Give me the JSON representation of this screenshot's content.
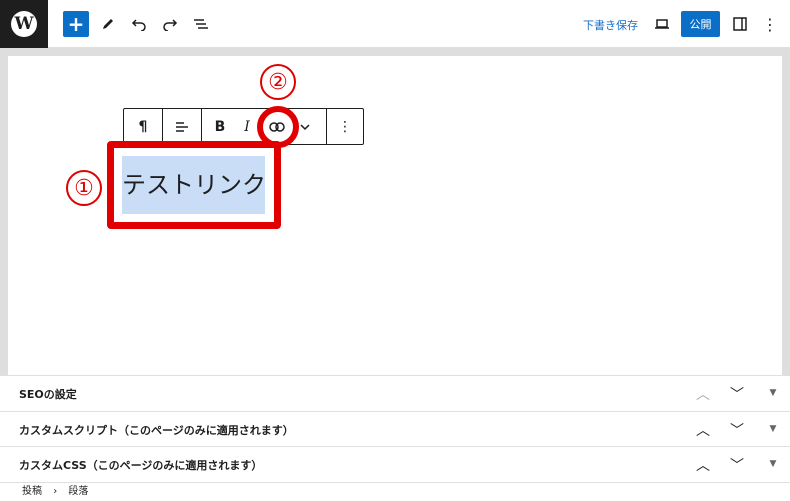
{
  "topbar": {
    "draft_save": "下書き保存",
    "publish": "公開"
  },
  "toolbar": {
    "paragraph": "¶",
    "bold": "B",
    "italic": "I",
    "more": "⋮"
  },
  "editor": {
    "selected_text": "テストリンク"
  },
  "annotations": {
    "one": "①",
    "two": "②"
  },
  "panels": [
    {
      "title": "SEOの設定"
    },
    {
      "title": "カスタムスクリプト（このページのみに適用されます）"
    },
    {
      "title": "カスタムCSS（このページのみに適用されます）"
    }
  ],
  "breadcrumb": {
    "first": "投稿",
    "separator": "›",
    "second": "段落"
  },
  "colors": {
    "accent": "#0b6ec7",
    "annotation": "#e00000",
    "selection": "#c9ddf7"
  }
}
